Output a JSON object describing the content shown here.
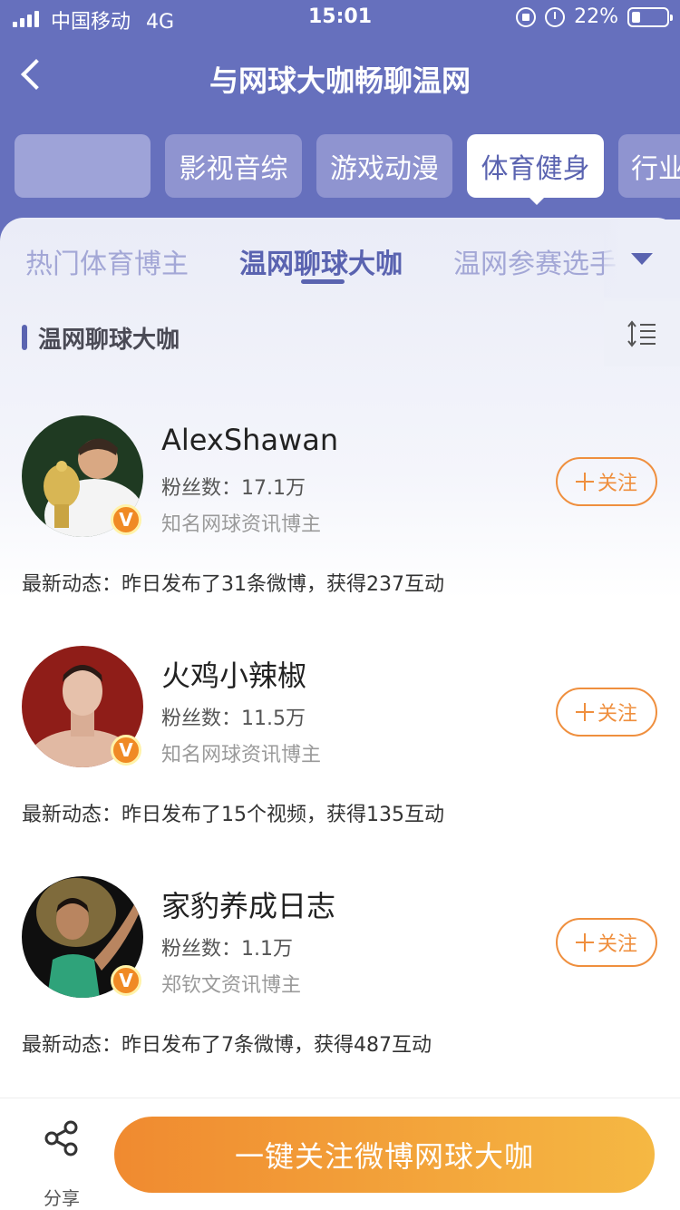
{
  "status_bar": {
    "carrier": "中国移动",
    "network": "4G",
    "time": "15:01",
    "battery": "22%"
  },
  "nav": {
    "title": "与网球大咖畅聊温网"
  },
  "categories": [
    {
      "label": "",
      "active": false
    },
    {
      "label": "影视音综",
      "active": false
    },
    {
      "label": "游戏动漫",
      "active": false
    },
    {
      "label": "体育健身",
      "active": true
    },
    {
      "label": "行业",
      "active": false
    }
  ],
  "sub_tabs": [
    {
      "label": "热门体育博主",
      "active": false
    },
    {
      "label": "温网聊球大咖",
      "active": true
    },
    {
      "label": "温网参赛选手",
      "active": false
    }
  ],
  "section": {
    "title": "温网聊球大咖"
  },
  "bloggers": [
    {
      "name": "AlexShawan",
      "fans": "粉丝数：17.1万",
      "desc": "知名网球资讯博主",
      "follow_label": "关注",
      "activity": "最新动态：昨日发布了31条微博，获得237互动",
      "verified": "V"
    },
    {
      "name": "火鸡小辣椒",
      "fans": "粉丝数：11.5万",
      "desc": "知名网球资讯博主",
      "follow_label": "关注",
      "activity": "最新动态：昨日发布了15个视频，获得135互动",
      "verified": "V"
    },
    {
      "name": "家豹养成日志",
      "fans": "粉丝数：1.1万",
      "desc": "郑钦文资讯博主",
      "follow_label": "关注",
      "activity": "最新动态：昨日发布了7条微博，获得487互动",
      "verified": "V"
    }
  ],
  "bottom": {
    "share_label": "分享",
    "cta_label": "一键关注微博网球大咖"
  },
  "colors": {
    "header": "#6670bd",
    "accent": "#5a63b0",
    "follow": "#ef8f3e",
    "cta_start": "#f08a30",
    "cta_end": "#f5b843"
  }
}
